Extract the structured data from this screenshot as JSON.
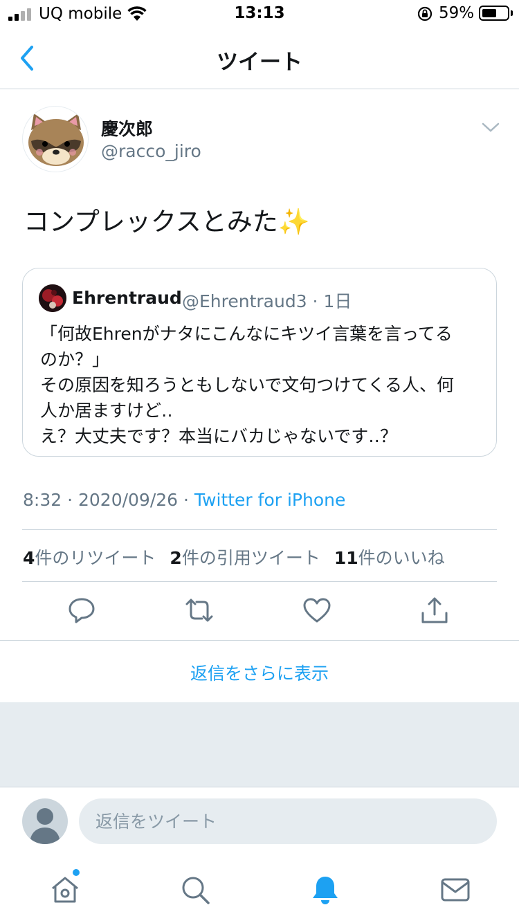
{
  "status_bar": {
    "carrier": "UQ mobile",
    "time": "13:13",
    "battery_percent": "59%",
    "battery_level": 0.59
  },
  "nav": {
    "back_icon": "chevron-left-icon",
    "title": "ツイート"
  },
  "tweet": {
    "display_name": "慶次郎",
    "handle": "@racco_jiro",
    "text": "コンプレックスとみた",
    "emoji": "✨",
    "quoted": {
      "name": "Ehrentraud",
      "handle_time": "@Ehrentraud3 · 1日",
      "lines": [
        "「何故Ehrenがナタにこんなにキツイ言葉を言ってる",
        "のか？」",
        "その原因を知ろうともしないで文句つけてくる人、何",
        "人か居ますけど‥",
        "え？大丈夫です？本当にバカじゃないです‥？"
      ]
    },
    "timestamp": "8:32 · 2020/09/26 · ",
    "source": "Twitter for iPhone",
    "stats": {
      "retweets_count": "4",
      "retweets_label": "件のリツイート",
      "quotes_count": "2",
      "quotes_label": "件の引用ツイート",
      "likes_count": "11",
      "likes_label": "件のいいね"
    }
  },
  "actions": [
    "reply-icon",
    "retweet-icon",
    "like-icon",
    "share-icon"
  ],
  "show_more_replies": "返信をさらに表示",
  "reply_bar": {
    "placeholder": "返信をツイート"
  },
  "tab_bar": [
    "home-icon",
    "search-icon",
    "notifications-icon",
    "messages-icon"
  ],
  "colors": {
    "accent": "#1da1f2",
    "secondary_text": "#657786",
    "divider": "#ccd6dd"
  }
}
